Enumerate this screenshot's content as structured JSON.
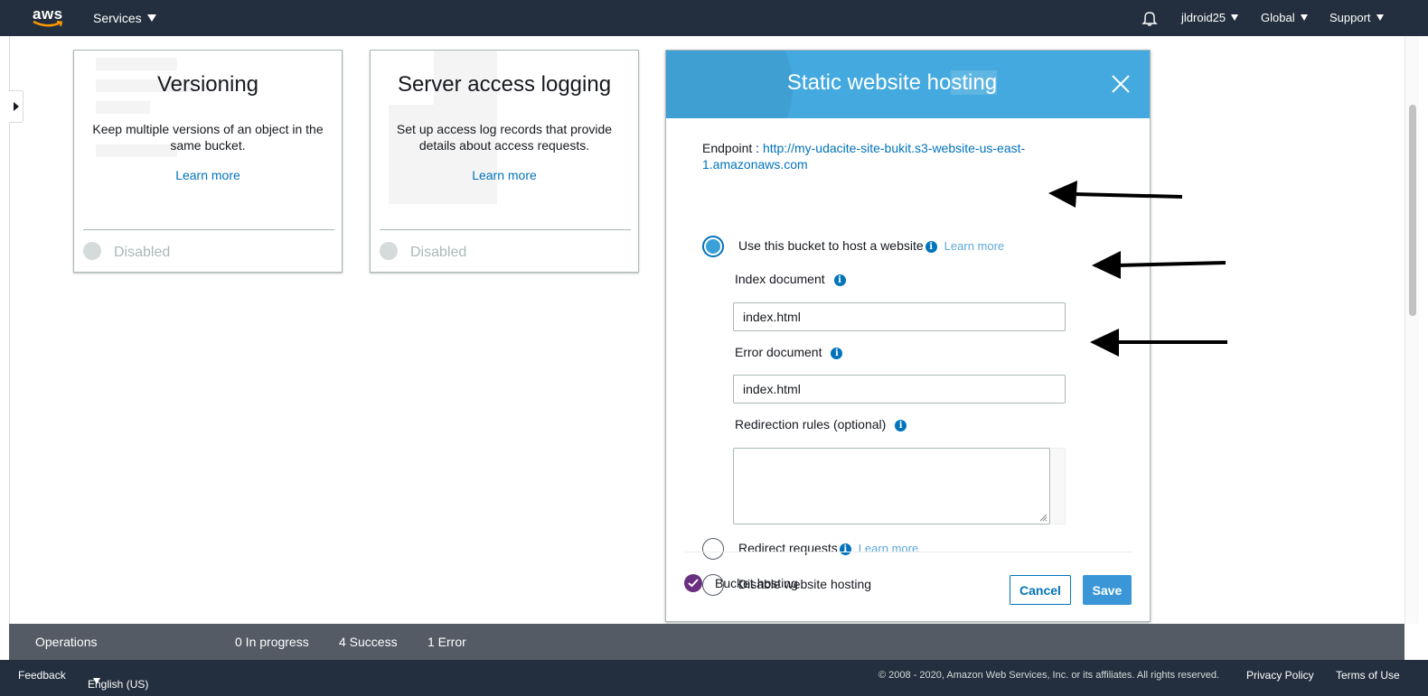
{
  "nav": {
    "logo_text": "aws",
    "services": "Services",
    "account": "jldroid25",
    "region": "Global",
    "support": "Support"
  },
  "cards": [
    {
      "title": "Versioning",
      "description": "Keep multiple versions of an object in the same bucket.",
      "link": "Learn more",
      "status": "Disabled"
    },
    {
      "title": "Server access logging",
      "description": "Set up access log records that provide details about access requests.",
      "link": "Learn more",
      "status": "Disabled"
    }
  ],
  "modal": {
    "title_prefix": "Static website ho",
    "title_highlight": "sting",
    "endpoint_label": "Endpoint : ",
    "endpoint_url": "http://my-udacite-site-bukit.s3-website-us-east-1.amazonaws.com",
    "options": {
      "host": "Use this bucket to host a website",
      "redirect": "Redirect requests",
      "disable": "Disable website hosting"
    },
    "learn_more": "Learn more",
    "index_label": "Index document",
    "index_value": "index.html",
    "error_label": "Error document",
    "error_value": "index.html",
    "redirection_label": "Redirection rules (optional)",
    "redirection_value": "",
    "bucket_hosting": "Bucket hosting",
    "cancel": "Cancel",
    "save": "Save"
  },
  "operations": {
    "label": "Operations",
    "in_progress": "0 In progress",
    "success": "4 Success",
    "error": "1 Error"
  },
  "footer": {
    "feedback": "Feedback",
    "language": "English (US)",
    "copyright": "© 2008 - 2020, Amazon Web Services, Inc. or its affiliates. All rights reserved.",
    "privacy": "Privacy Policy",
    "terms": "Terms of Use"
  },
  "colors": {
    "nav_bg": "#232f3e",
    "modal_header": "#44a9de",
    "link": "#0073bb",
    "save_button": "#3a96d7",
    "ops_bar": "#545b64",
    "check_purple": "#6b2f82"
  }
}
